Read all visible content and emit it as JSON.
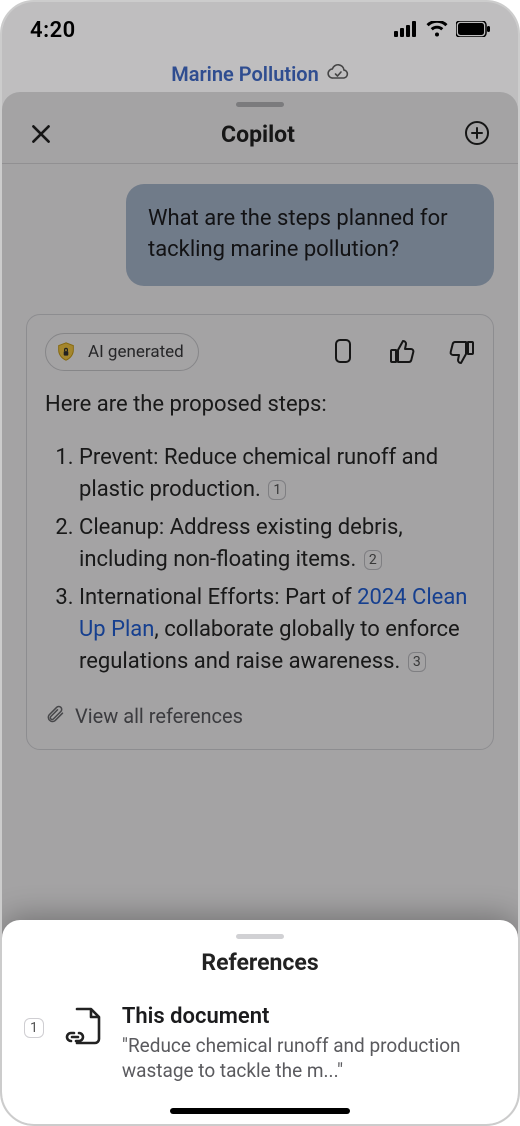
{
  "status": {
    "time": "4:20"
  },
  "document": {
    "title": "Marine Pollution"
  },
  "copilot": {
    "title": "Copilot",
    "user_message": "What are the steps planned for tackling marine pollution?",
    "ai_badge_label": "AI generated",
    "ai_intro": "Here are the proposed steps:",
    "steps": [
      {
        "text_before": "Prevent: Reduce chemical runoff and plastic production.",
        "cite": "1",
        "text_after": ""
      },
      {
        "text_before": "Cleanup: Address existing debris, including non-floating items.",
        "cite": "2",
        "text_after": ""
      },
      {
        "text_before": "International Efforts: Part of ",
        "link": "2024 Clean Up Plan",
        "text_after": ", collaborate globally to enforce regulations and raise awareness.",
        "cite": "3"
      }
    ],
    "view_refs_label": "View all references"
  },
  "references": {
    "title": "References",
    "items": [
      {
        "num": "1",
        "title": "This document",
        "snippet": "\"Reduce chemical runoff and production wastage to tackle the m...\""
      }
    ]
  }
}
